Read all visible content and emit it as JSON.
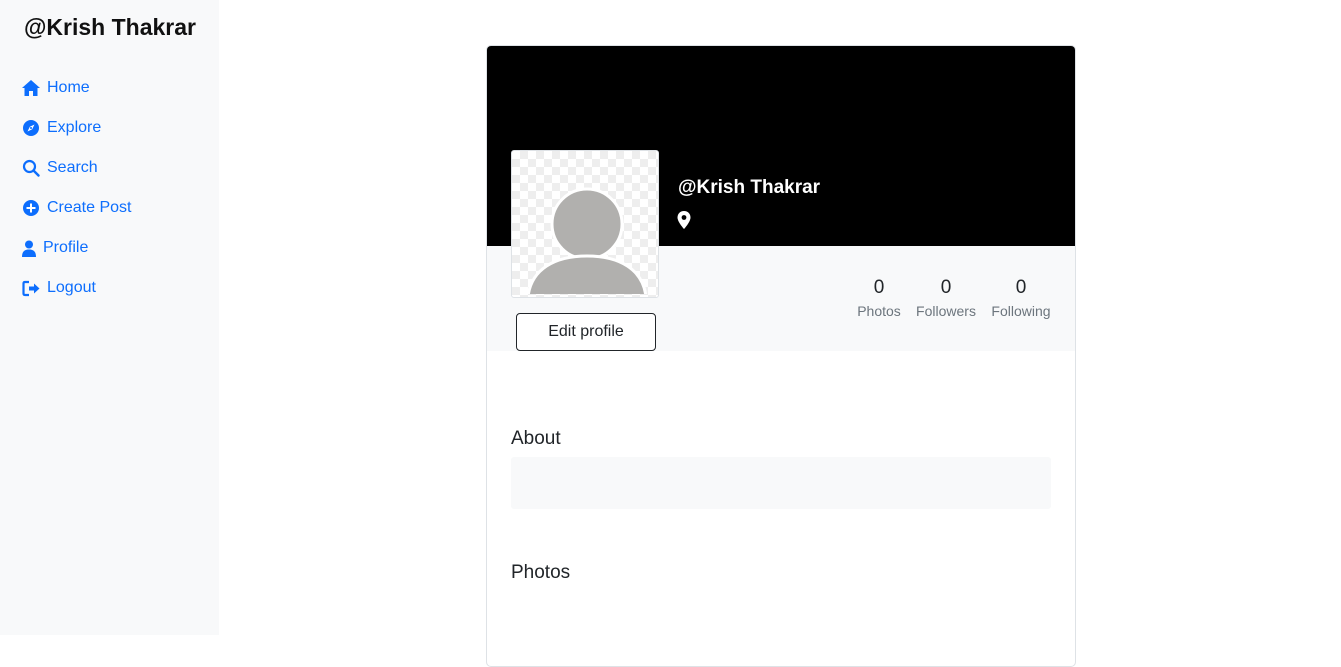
{
  "sidebar": {
    "brand": "@Krish Thakrar",
    "items": [
      {
        "label": "Home",
        "icon": "home-icon"
      },
      {
        "label": "Explore",
        "icon": "compass-icon"
      },
      {
        "label": "Search",
        "icon": "search-icon"
      },
      {
        "label": "Create Post",
        "icon": "plus-circle-icon"
      },
      {
        "label": "Profile",
        "icon": "user-icon"
      },
      {
        "label": "Logout",
        "icon": "logout-icon"
      }
    ]
  },
  "profile": {
    "username": "@Krish Thakrar",
    "edit_label": "Edit profile",
    "stats": [
      {
        "value": "0",
        "label": "Photos"
      },
      {
        "value": "0",
        "label": "Followers"
      },
      {
        "value": "0",
        "label": "Following"
      }
    ]
  },
  "sections": {
    "about_title": "About",
    "photos_title": "Photos"
  },
  "colors": {
    "accent": "#0d6efd",
    "cover": "#000000",
    "band": "#f8f9fa"
  }
}
